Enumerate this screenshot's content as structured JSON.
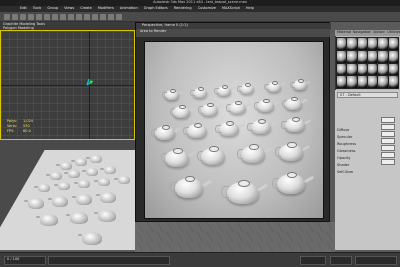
{
  "window": {
    "title": "Autodesk 3ds Max 2011 x64 - test_teapot_scene.max"
  },
  "menu": [
    "Edit",
    "Tools",
    "Group",
    "Views",
    "Create",
    "Modifiers",
    "Animation",
    "Graph Editors",
    "Rendering",
    "Customize",
    "MAXScript",
    "Help"
  ],
  "ribbon": {
    "tab_label": "Graphite Modeling Tools",
    "sub_label": "Polygon Modeling"
  },
  "render_window": {
    "title": "Perspective, frame 0 (1:1)",
    "preset_label": "Area to Render"
  },
  "material_editor": {
    "tabs": [
      "Material",
      "Navigation",
      "Options",
      "Utilities"
    ],
    "slot_count": 24,
    "material_name": "07 - Default",
    "params": [
      "Diffuse",
      "Specular",
      "Roughness",
      "Glossiness",
      "Opacity",
      "Shader",
      "Self-Illum"
    ]
  },
  "left_panel_stats": {
    "labels": [
      "Polys:",
      "Verts:",
      "FPS:"
    ],
    "values": [
      "1,024",
      "530",
      "60.0"
    ]
  },
  "statusbar": {
    "frame": "0 / 100"
  },
  "colors": {
    "viewport_active_border": "#d8c800",
    "axis_cyan": "#00c8e0"
  }
}
